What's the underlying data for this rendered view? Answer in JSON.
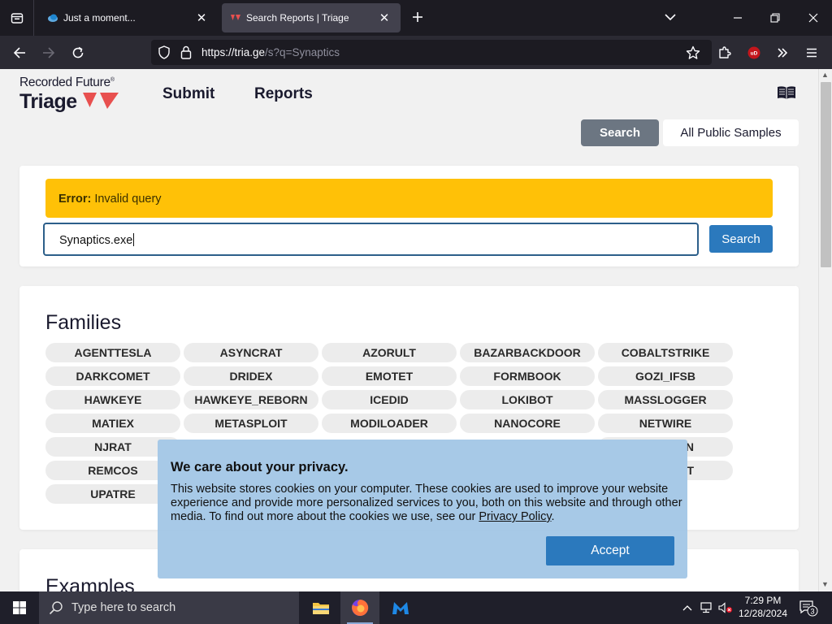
{
  "browser": {
    "tabs": [
      {
        "title": "Just a moment..."
      },
      {
        "title": "Search Reports | Triage"
      }
    ],
    "url_host": "https://tria.ge",
    "url_path": "/s?q=Synaptics",
    "ublock_badge": "uD"
  },
  "site": {
    "logo_line1": "Recorded Future",
    "logo_reg": "®",
    "logo_line2": "Triage",
    "nav": {
      "submit": "Submit",
      "reports": "Reports"
    },
    "toggle": {
      "search": "Search",
      "public": "All Public Samples"
    }
  },
  "search": {
    "error_label": "Error:",
    "error_text": " Invalid query",
    "query": "Synaptics.exe",
    "button": "Search"
  },
  "families": {
    "title": "Families",
    "items": [
      "AGENTTESLA",
      "ASYNCRAT",
      "AZORULT",
      "BAZARBACKDOOR",
      "COBALTSTRIKE",
      "DARKCOMET",
      "DRIDEX",
      "EMOTET",
      "FORMBOOK",
      "GOZI_IFSB",
      "HAWKEYE",
      "HAWKEYE_REBORN",
      "ICEDID",
      "LOKIBOT",
      "MASSLOGGER",
      "MATIEX",
      "METASPLOIT",
      "MODILOADER",
      "NANOCORE",
      "NETWIRE",
      "NJRAT",
      "N",
      "REMCOS",
      "T",
      "UPATRE"
    ]
  },
  "examples": {
    "title": "Examples"
  },
  "privacy": {
    "title": "We care about your privacy.",
    "text": "This website stores cookies on your computer. These cookies are used to improve your website experience and provide more personalized services to you, both on this website and through other media. To find out more about the cookies we use, see our ",
    "link": "Privacy Policy",
    "text_end": ".",
    "accept": "Accept"
  },
  "taskbar": {
    "search_placeholder": "Type here to search",
    "time": "7:29 PM",
    "date": "12/28/2024",
    "notifications": "3"
  },
  "colors": {
    "accent": "#2b79bd",
    "error_bg": "#ffc107",
    "toggle_active": "#6c7682",
    "privacy_bg": "#a3c7e6"
  }
}
